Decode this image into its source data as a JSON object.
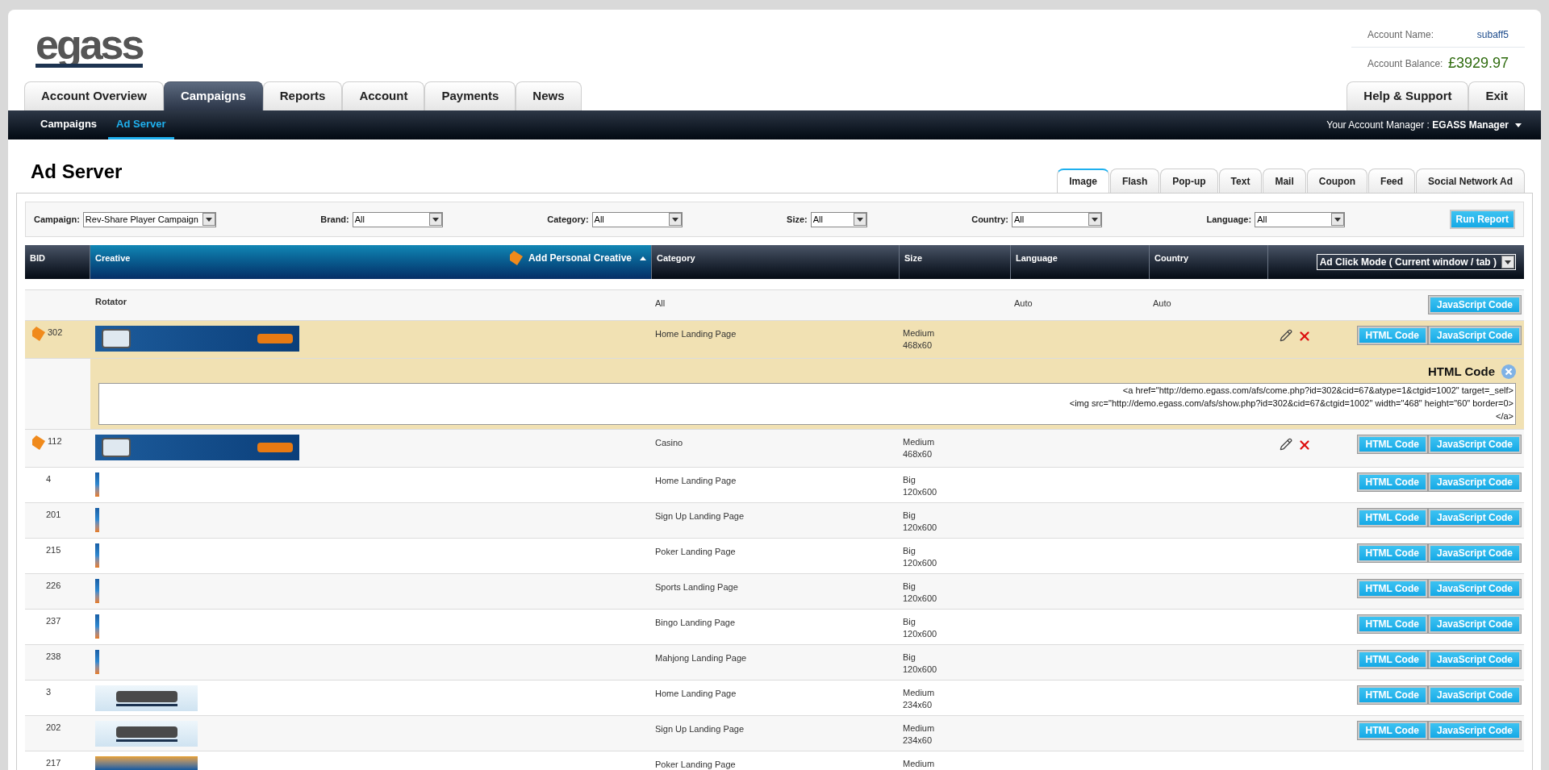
{
  "logo": "egass",
  "account": {
    "name_label": "Account Name:",
    "name_value": "subaff5",
    "balance_label": "Account Balance:",
    "balance_value": "£3929.97"
  },
  "main_tabs": [
    {
      "label": "Account Overview",
      "selected": false
    },
    {
      "label": "Campaigns",
      "selected": true
    },
    {
      "label": "Reports",
      "selected": false
    },
    {
      "label": "Account",
      "selected": false
    },
    {
      "label": "Payments",
      "selected": false
    },
    {
      "label": "News",
      "selected": false
    }
  ],
  "right_tabs": [
    {
      "label": "Help & Support"
    },
    {
      "label": "Exit"
    }
  ],
  "sub_nav": [
    {
      "label": "Campaigns",
      "selected": false
    },
    {
      "label": "Ad Server",
      "selected": true
    }
  ],
  "account_manager": "Your Account Manager : **EGASS Manager**",
  "page_title": "Ad Server",
  "type_tabs": [
    {
      "label": "Image",
      "selected": true
    },
    {
      "label": "Flash",
      "selected": false
    },
    {
      "label": "Pop-up",
      "selected": false
    },
    {
      "label": "Text",
      "selected": false
    },
    {
      "label": "Mail",
      "selected": false
    },
    {
      "label": "Coupon",
      "selected": false
    },
    {
      "label": "Feed",
      "selected": false
    },
    {
      "label": "Social Network Ad",
      "selected": false
    }
  ],
  "filters": [
    {
      "label": "Campaign:",
      "value": "Rev-Share Player Campaign"
    },
    {
      "label": "Brand:",
      "value": "All"
    },
    {
      "label": "Category:",
      "value": "All"
    },
    {
      "label": "Size:",
      "value": "All"
    },
    {
      "label": "Country:",
      "value": "All"
    },
    {
      "label": "Language:",
      "value": "All"
    }
  ],
  "run_report": "Run Report",
  "table": {
    "columns": [
      {
        "label": "BID",
        "selected": false
      },
      {
        "label": "Creative",
        "selected": true
      },
      {
        "label": "Category",
        "selected": false
      },
      {
        "label": "Size",
        "selected": false
      },
      {
        "label": "Language",
        "selected": false
      },
      {
        "label": "Country",
        "selected": false
      }
    ],
    "add_personal_creative": "Add Personal Creative",
    "click_mode": "Ad Click Mode ( Current window / tab )",
    "rows": [
      {
        "kind": "rotator",
        "selected": false,
        "bid": "",
        "label": "Rotator",
        "category": "All",
        "size": [],
        "language": "Auto",
        "country": "Auto",
        "buttons": [
          "JavaScript Code"
        ]
      },
      {
        "kind": "creative",
        "thumbnail": {
          "kind": "banner"
        },
        "personal": true,
        "selected": true,
        "bid": "302",
        "category": "Home Landing Page",
        "size": [
          "Medium",
          "468x60"
        ],
        "buttons": [
          "HTML Code",
          "JavaScript Code"
        ],
        "code_panel": {
          "title": "HTML Code",
          "lines": [
            "<a href=\"http://demo.egass.com/afs/come.php?id=302&cid=67&atype=1&ctgid=1002\" target=_self>",
            "<img src=\"http://demo.egass.com/afs/show.php?id=302&cid=67&ctgid=1002\" width=\"468\" height=\"60\" border=0>",
            "</a>"
          ]
        }
      },
      {
        "kind": "creative",
        "thumbnail": {
          "kind": "banner"
        },
        "personal": true,
        "selected": false,
        "bid": "112",
        "category": "Casino",
        "size": [
          "Medium",
          "468x60"
        ],
        "buttons": [
          "HTML Code",
          "JavaScript Code"
        ]
      },
      {
        "kind": "creative",
        "thumbnail": {
          "kind": "skyscraper"
        },
        "personal": false,
        "selected": false,
        "bid": "4",
        "category": "Home Landing Page",
        "size": [
          "Big",
          "120x600"
        ],
        "buttons": [
          "HTML Code",
          "JavaScript Code"
        ]
      },
      {
        "kind": "creative",
        "thumbnail": {
          "kind": "skyscraper"
        },
        "personal": false,
        "selected": false,
        "bid": "201",
        "category": "Sign Up Landing Page",
        "size": [
          "Big",
          "120x600"
        ],
        "buttons": [
          "HTML Code",
          "JavaScript Code"
        ]
      },
      {
        "kind": "creative",
        "thumbnail": {
          "kind": "skyscraper"
        },
        "personal": false,
        "selected": false,
        "bid": "215",
        "category": "Poker Landing Page",
        "size": [
          "Big",
          "120x600"
        ],
        "buttons": [
          "HTML Code",
          "JavaScript Code"
        ]
      },
      {
        "kind": "creative",
        "thumbnail": {
          "kind": "skyscraper"
        },
        "personal": false,
        "selected": false,
        "bid": "226",
        "category": "Sports Landing Page",
        "size": [
          "Big",
          "120x600"
        ],
        "buttons": [
          "HTML Code",
          "JavaScript Code"
        ]
      },
      {
        "kind": "creative",
        "thumbnail": {
          "kind": "skyscraper"
        },
        "personal": false,
        "selected": false,
        "bid": "237",
        "category": "Bingo Landing Page",
        "size": [
          "Big",
          "120x600"
        ],
        "buttons": [
          "HTML Code",
          "JavaScript Code"
        ]
      },
      {
        "kind": "creative",
        "thumbnail": {
          "kind": "skyscraper"
        },
        "personal": false,
        "selected": false,
        "bid": "238",
        "category": "Mahjong Landing Page",
        "size": [
          "Big",
          "120x600"
        ],
        "buttons": [
          "HTML Code",
          "JavaScript Code"
        ]
      },
      {
        "kind": "creative",
        "thumbnail": {
          "kind": "logo"
        },
        "personal": false,
        "selected": false,
        "bid": "3",
        "category": "Home Landing Page",
        "size": [
          "Medium",
          "234x60"
        ],
        "buttons": [
          "HTML Code",
          "JavaScript Code"
        ]
      },
      {
        "kind": "creative",
        "thumbnail": {
          "kind": "logo"
        },
        "personal": false,
        "selected": false,
        "bid": "202",
        "category": "Sign Up Landing Page",
        "size": [
          "Medium",
          "234x60"
        ],
        "buttons": [
          "HTML Code",
          "JavaScript Code"
        ]
      },
      {
        "kind": "creative",
        "thumbnail": {
          "kind": "promo"
        },
        "personal": false,
        "selected": false,
        "bid": "217",
        "category": "Poker Landing Page",
        "size": [
          "Medium"
        ],
        "buttons": []
      }
    ]
  }
}
